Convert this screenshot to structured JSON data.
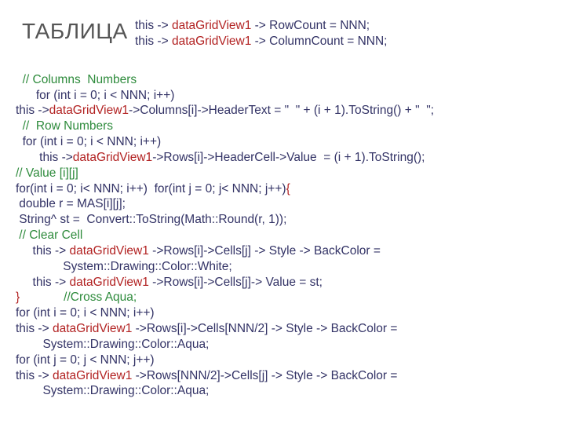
{
  "title": "ТАБЛИЦА",
  "head": {
    "l1a": "this -> ",
    "l1b": "dataGridView1",
    "l1c": " -> RowCount = NNN;",
    "l2a": "this -> ",
    "l2b": "dataGridView1",
    "l2c": " -> ColumnCount = NNN;"
  },
  "c": {
    "l3": "  // Columns  Numbers",
    "l4a": "      for (int i = 0; i < NNN; i++)",
    "l5a": "this ->",
    "l5b": "dataGridView1",
    "l5c": "->Columns[i]->HeaderText = \"  \" + (i + 1).ToString() + \"  \";",
    "l6": "  //  Row Numbers",
    "l7": "  for (int i = 0; i < NNN; i++)",
    "l8a": "       this ->",
    "l8b": "dataGridView1",
    "l8c": "->Rows[i]->HeaderCell->Value  = (i + 1).ToString();",
    "l9": "// Value [i][j]",
    "l10a": "for(int i = 0; i< NNN; i++)  for(int j = 0; j< NNN; j++)",
    "l10b": "{",
    "l11": " double r = MAS[i][j];",
    "l12": " String^ st =  Convert::ToString(Math::Round(r, 1));",
    "l13": " // Clear Cell",
    "l14a": "     this -> ",
    "l14b": "dataGridView1",
    "l14c": " ->Rows[i]->Cells[j] -> Style -> BackColor =",
    "l15": "              System::Drawing::Color::White;",
    "l16a": "     this -> ",
    "l16b": "dataGridView1",
    "l16c": " ->Rows[i]->Cells[j]-> Value = st;",
    "l17a": "}",
    "l17b": "             //Cross Aqua;",
    "l18": "for (int i = 0; i < NNN; i++)",
    "l19a": "this -> ",
    "l19b": "dataGridView1",
    "l19c": " ->Rows[i]->Cells[NNN/2] -> Style -> BackColor =",
    "l20": "        System::Drawing::Color::Aqua;",
    "l21": "for (int j = 0; j < NNN; j++)",
    "l22a": "this -> ",
    "l22b": "dataGridView1",
    "l22c": " ->Rows[NNN/2]->Cells[j] -> Style -> BackColor =",
    "l23": "        System::Drawing::Color::Aqua;"
  }
}
